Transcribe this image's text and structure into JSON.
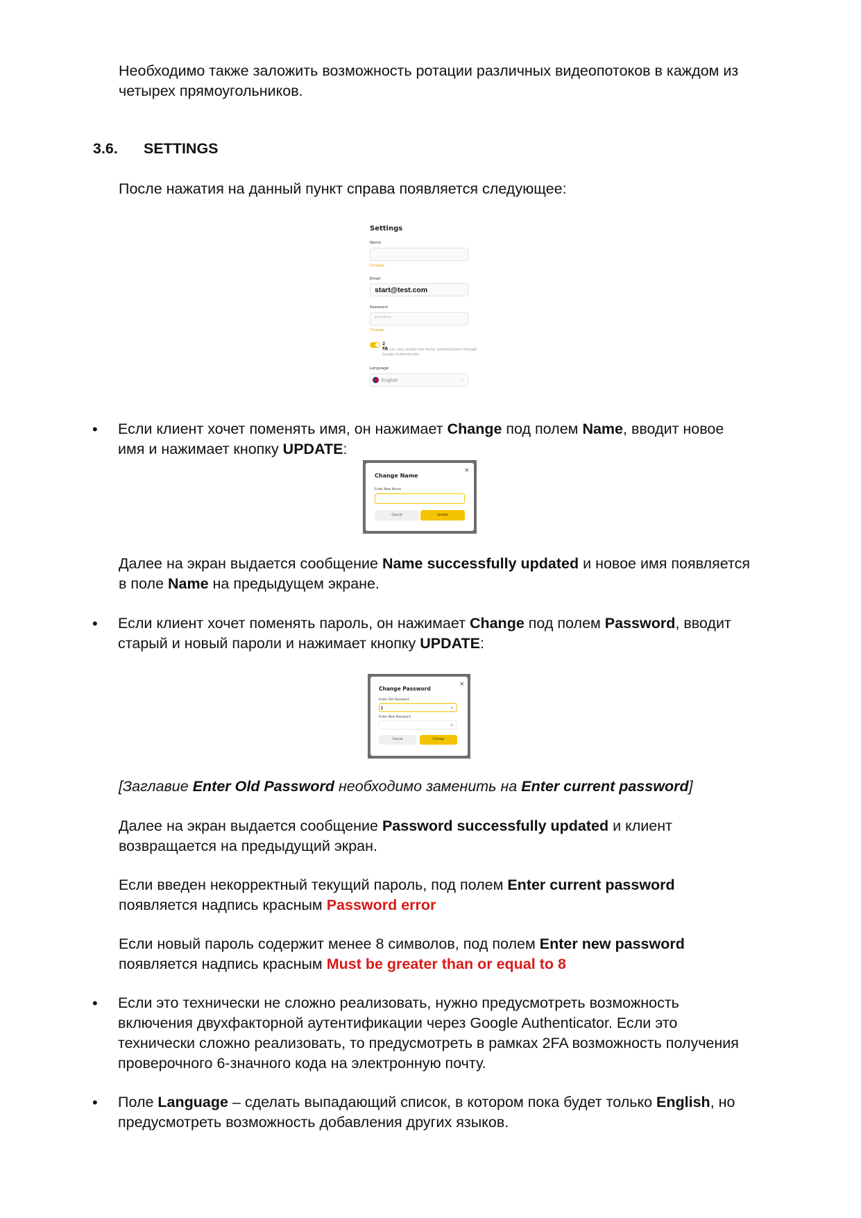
{
  "intro": {
    "line1": "Необходимо также заложить возможность ротации различных видеопотоков в каждом из",
    "line2": "четырех прямоугольников."
  },
  "section": {
    "number": "3.6.",
    "title": "SETTINGS"
  },
  "after_click": "После нажатия на данный пункт справа появляется следующее:",
  "settings_screen": {
    "title": "Settings",
    "name_label": "Name",
    "name_change": "Change",
    "email_label": "Email",
    "email_value": "start@test.com",
    "password_label": "Password",
    "password_dots": "•••••••",
    "password_change": "Change",
    "twofa_label": "2 FA",
    "twofa_desc": "You can only enable two-factor authentication through Google Authenticator",
    "language_label": "Language",
    "language_value": "English",
    "toggle_color": "#f2c200"
  },
  "bullet1": {
    "bullet": "•",
    "t1": "Если клиент хочет поменять имя, он нажимает ",
    "b1": "Change",
    "t2": " под полем ",
    "b2": "Name",
    "t3": ", вводит новое",
    "t4": "имя и нажимает кнопку ",
    "b3": "UPDATE",
    "t5": ":"
  },
  "change_name_dialog": {
    "title": "Change Name",
    "close": "×",
    "label": "Enter New Name",
    "cancel": "Cancel",
    "update": "Update"
  },
  "name_result": {
    "t1": "Далее на экран выдается сообщение ",
    "b1": "Name successfully updated",
    "t2": " и новое имя появляется",
    "t3": "в поле ",
    "b2": "Name",
    "t4": " на предыдущем экране."
  },
  "bullet2": {
    "bullet": "•",
    "t1": "Если клиент хочет поменять пароль, он нажимает ",
    "b1": "Change",
    "t2": " под полем ",
    "b2": "Password",
    "t3": ", вводит",
    "t4": "старый и новый пароли и нажимает кнопку ",
    "b3": "UPDATE",
    "t5": ":"
  },
  "change_password_dialog": {
    "title": "Change Password",
    "close": "×",
    "old_label": "Enter Old Password",
    "new_label": "Enter New Password",
    "cancel": "Cancel",
    "change": "Change"
  },
  "note": {
    "t1": "[Заглавие ",
    "b1": "Enter Old Password",
    "t2": " необходимо заменить на ",
    "b2": "Enter current password",
    "t3": "]"
  },
  "password_result": {
    "t1": "Далее на экран выдается сообщение ",
    "b1": "Password successfully updated",
    "t2": " и клиент",
    "t3": "возвращается на предыдущий экран."
  },
  "wrong_current": {
    "t1": "Если введен некорректный текущий пароль, под полем ",
    "b1": "Enter current password",
    "t2": "появляется надпись красным ",
    "r1": "Password error"
  },
  "short_new": {
    "t1": "Если новый пароль содержит менее 8 символов, под полем ",
    "b1": "Enter new password",
    "t2": "появляется надпись красным ",
    "r1": "Must be greater than or equal to 8"
  },
  "bullet3": {
    "bullet": "•",
    "l1": "Если это технически не сложно реализовать, нужно предусмотреть возможность",
    "l2": "включения двухфакторной аутентификации через Google Authenticator. Если это",
    "l3": "технически сложно реализовать, то предусмотреть в рамках 2FA возможность получения",
    "l4": "проверочного 6-значного кода на электронную почту."
  },
  "bullet4": {
    "bullet": "•",
    "t1": "Поле ",
    "b1": "Language",
    "t2": " – сделать выпадающий список, в котором пока будет только ",
    "b2": "English",
    "t3": ", но",
    "t4": "предусмотреть возможность добавления других языков."
  },
  "colors": {
    "accent_yellow": "#f5c400",
    "error_red": "#d91a1a"
  }
}
